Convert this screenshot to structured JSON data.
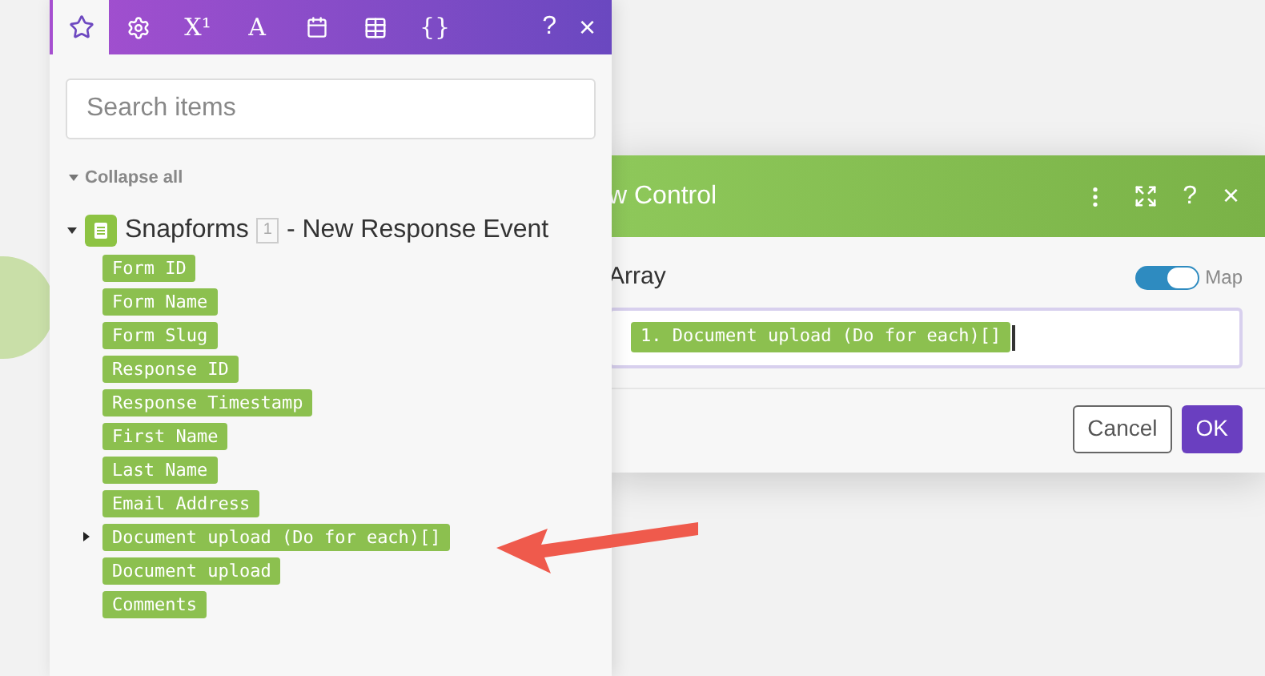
{
  "panel": {
    "tabs": [
      {
        "kind": "star",
        "selected": true
      },
      {
        "kind": "gear",
        "selected": false
      },
      {
        "kind": "text",
        "label": "X¹",
        "selected": false
      },
      {
        "kind": "text",
        "label": "A",
        "selected": false
      },
      {
        "kind": "calendar",
        "selected": false
      },
      {
        "kind": "table",
        "selected": false
      },
      {
        "kind": "text",
        "label": "{}",
        "selected": false
      }
    ],
    "help": "?",
    "close": "×",
    "search": {
      "placeholder": "Search items"
    },
    "collapse_all": "Collapse all",
    "tree": {
      "app": "Snapforms",
      "badge": "1",
      "title": "- New Response Event",
      "expanded": true,
      "children": [
        {
          "label": "Form ID"
        },
        {
          "label": "Form Name"
        },
        {
          "label": "Form Slug"
        },
        {
          "label": "Response ID"
        },
        {
          "label": "Response Timestamp"
        },
        {
          "label": "First Name"
        },
        {
          "label": "Last Name"
        },
        {
          "label": "Email Address"
        },
        {
          "label": "Document upload (Do for each)[]",
          "expanded": false
        },
        {
          "label": "Document upload"
        },
        {
          "label": "Comments"
        }
      ]
    }
  },
  "dialog": {
    "title": "w Control",
    "help": "?",
    "close": "×",
    "field_label": "Array",
    "map_toggle": {
      "label": "Map",
      "on": true
    },
    "value_token": "1. Document upload (Do for each)[]",
    "buttons": [
      "Cancel",
      "OK"
    ]
  }
}
